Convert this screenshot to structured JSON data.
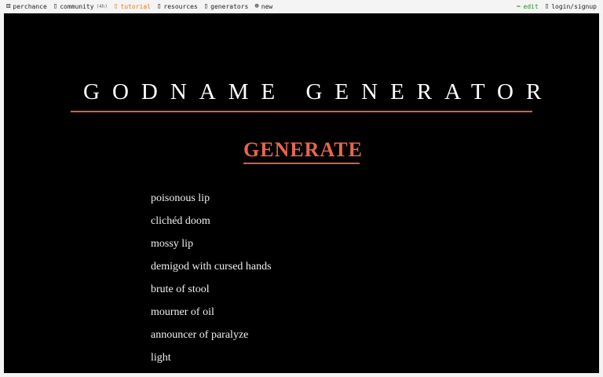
{
  "nav": {
    "left": [
      {
        "icon": "⚄",
        "label": "perchance",
        "name": "perchance"
      },
      {
        "icon": "▯",
        "label": "community",
        "extra": "(4h)",
        "name": "community"
      },
      {
        "icon": "▯",
        "label": "tutorial",
        "name": "tutorial"
      },
      {
        "icon": "▯",
        "label": "resources",
        "name": "resources"
      },
      {
        "icon": "▯",
        "label": "generators",
        "name": "generators"
      },
      {
        "icon": "⊕",
        "label": "new",
        "name": "new"
      }
    ],
    "right": [
      {
        "icon": "✏",
        "label": "edit",
        "name": "edit"
      },
      {
        "icon": "▯",
        "label": "login/signup",
        "name": "login-signup"
      }
    ]
  },
  "page": {
    "title": "GODNAME GENERATOR",
    "generate_label": "GENERATE"
  },
  "results": [
    "poisonous lip",
    "clichéd doom",
    "mossy lip",
    "demigod with cursed hands",
    "brute of stool",
    "mourner of oil",
    "announcer of paralyze",
    "light"
  ],
  "colors": {
    "accent": "#e8664c",
    "background": "#000000",
    "text": "#f0f0f0",
    "tutorial": "#e07a22",
    "edit": "#2c8a2c"
  }
}
